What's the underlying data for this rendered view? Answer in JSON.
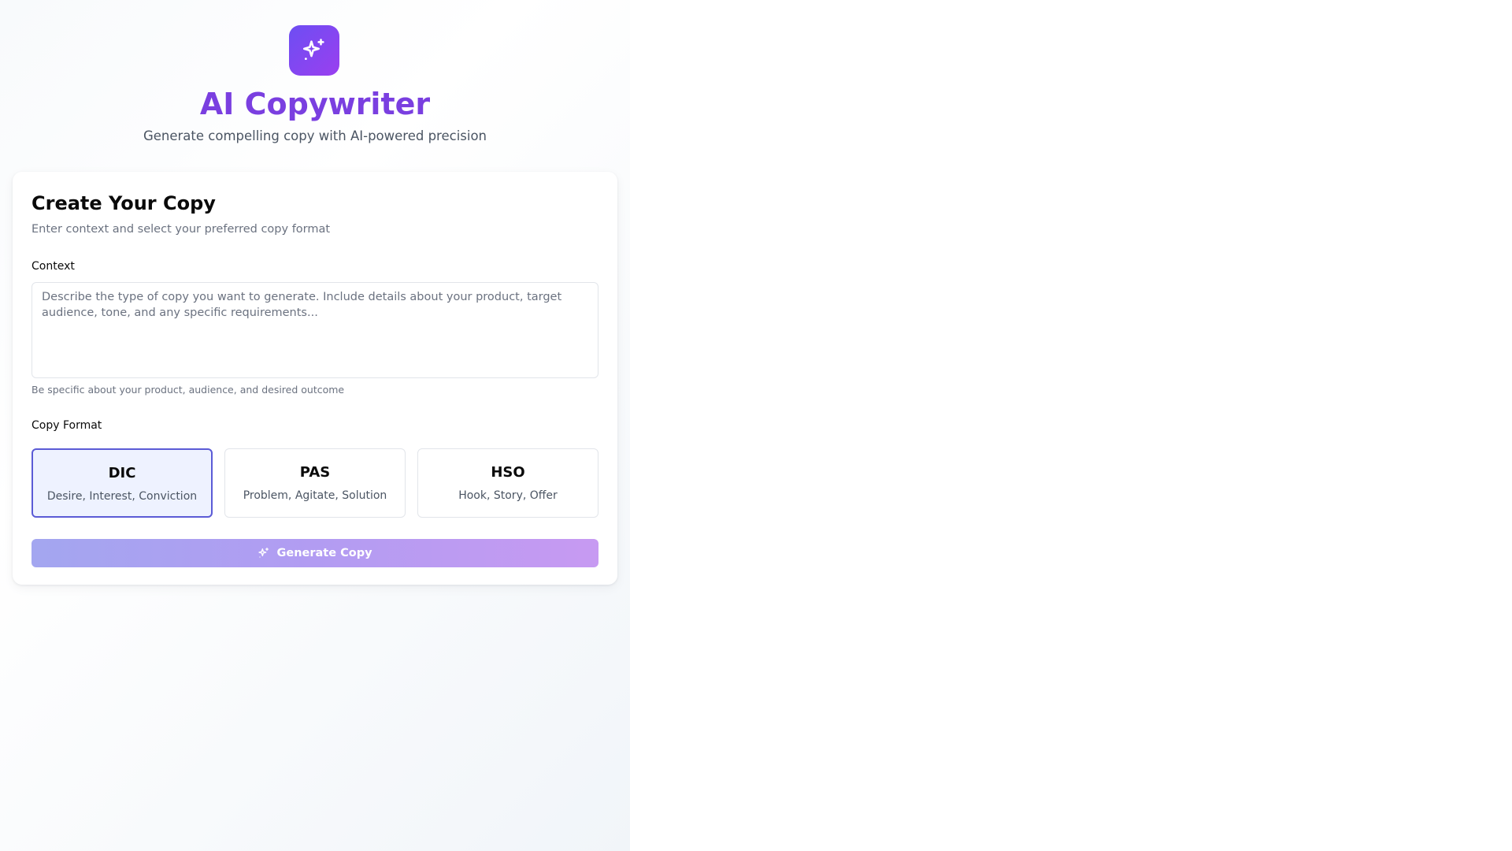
{
  "header": {
    "logo_icon": "sparkles-icon",
    "title": "AI Copywriter",
    "subtitle": "Generate compelling copy with AI-powered precision"
  },
  "card": {
    "title": "Create Your Copy",
    "description": "Enter context and select your preferred copy format",
    "context": {
      "label": "Context",
      "value": "",
      "placeholder": "Describe the type of copy you want to generate. Include details about your product, target audience, tone, and any specific requirements...",
      "hint": "Be specific about your product, audience, and desired outcome"
    },
    "format": {
      "label": "Copy Format",
      "selected": "DIC",
      "options": [
        {
          "name": "DIC",
          "description": "Desire, Interest, Conviction"
        },
        {
          "name": "PAS",
          "description": "Problem, Agitate, Solution"
        },
        {
          "name": "HSO",
          "description": "Hook, Story, Offer"
        }
      ]
    },
    "generate_button": {
      "label": "Generate Copy",
      "icon": "sparkles-icon"
    }
  },
  "colors": {
    "brand": "#7a3fe0",
    "accent": "#5b5bd6",
    "selected_bg": "#eef2ff"
  }
}
